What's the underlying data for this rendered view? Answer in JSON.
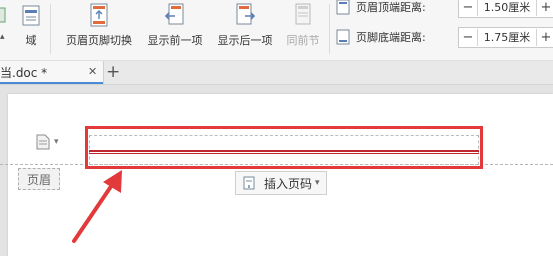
{
  "ribbon": {
    "field_label": "域",
    "header_footer_switch_label": "页眉页脚切换",
    "show_previous_label": "显示前一项",
    "show_next_label": "显示后一项",
    "same_as_previous_label": "同前节",
    "header_top_distance_label": "页眉顶端距离:",
    "header_top_distance_value": "1.50厘米",
    "footer_bottom_distance_label": "页脚底端距离:",
    "footer_bottom_distance_value": "1.75厘米",
    "minus_symbol": "−",
    "plus_symbol": "+"
  },
  "tabs": {
    "doc_tab_title": "当.doc *",
    "close_symbol": "✕",
    "new_tab_symbol": "+"
  },
  "page": {
    "header_tag": "页眉",
    "insert_page_number_label": "插入页码",
    "dropdown_arrow": "▾"
  },
  "colors": {
    "accent_red": "#e23a3a",
    "header_line_red": "#c0272d",
    "tab_accent_blue": "#4a8bd6"
  },
  "icons": {
    "field": "field-icon",
    "header_footer_switch": "header-footer-switch-icon",
    "show_previous": "show-previous-icon",
    "show_next": "show-next-icon",
    "same_as_previous": "same-as-previous-icon",
    "page_options": "page-options-icon"
  }
}
